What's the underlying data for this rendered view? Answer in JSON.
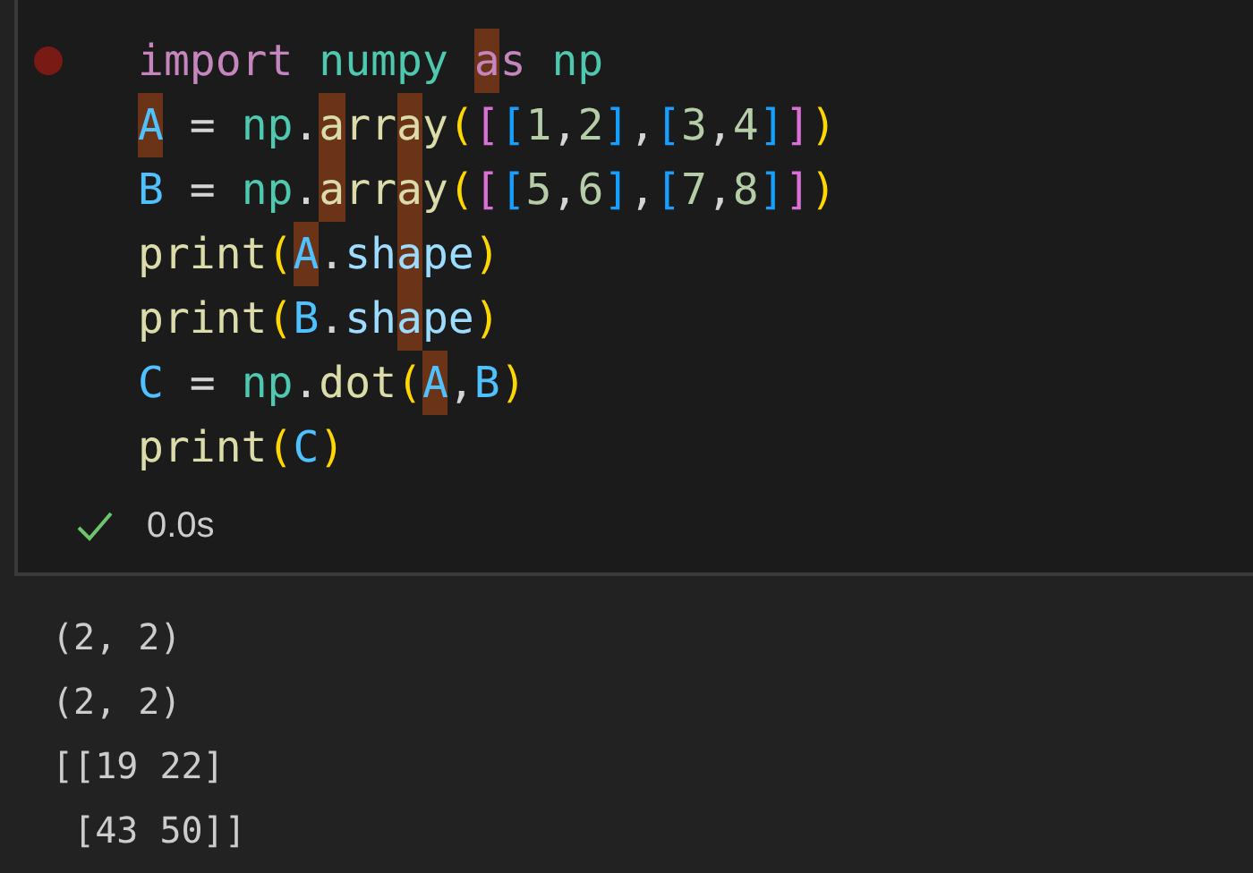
{
  "cell": {
    "breakpoint": true,
    "lines": [
      {
        "tokens": [
          {
            "text": "import ",
            "kind": "keyword",
            "highlighted": false
          },
          {
            "text": "numpy ",
            "kind": "module",
            "highlighted": false
          },
          {
            "text": "a",
            "kind": "keyword",
            "highlighted": true
          },
          {
            "text": "s ",
            "kind": "keyword",
            "highlighted": false
          },
          {
            "text": "np",
            "kind": "module",
            "highlighted": false
          }
        ]
      },
      {
        "tokens": [
          {
            "text": "A",
            "kind": "variable",
            "highlighted": true
          },
          {
            "text": " = ",
            "kind": "plain",
            "highlighted": false
          },
          {
            "text": "np",
            "kind": "module",
            "highlighted": false
          },
          {
            "text": ".",
            "kind": "plain",
            "highlighted": false
          },
          {
            "text": "a",
            "kind": "function",
            "highlighted": true
          },
          {
            "text": "rr",
            "kind": "function",
            "highlighted": false
          },
          {
            "text": "a",
            "kind": "function",
            "highlighted": true
          },
          {
            "text": "y",
            "kind": "function",
            "highlighted": false
          },
          {
            "text": "(",
            "kind": "bracket1",
            "highlighted": false
          },
          {
            "text": "[",
            "kind": "bracket2",
            "highlighted": false
          },
          {
            "text": "[",
            "kind": "bracket3",
            "highlighted": false
          },
          {
            "text": "1",
            "kind": "number",
            "highlighted": false
          },
          {
            "text": ",",
            "kind": "plain",
            "highlighted": false
          },
          {
            "text": "2",
            "kind": "number",
            "highlighted": false
          },
          {
            "text": "]",
            "kind": "bracket3",
            "highlighted": false
          },
          {
            "text": ",",
            "kind": "plain",
            "highlighted": false
          },
          {
            "text": "[",
            "kind": "bracket3",
            "highlighted": false
          },
          {
            "text": "3",
            "kind": "number",
            "highlighted": false
          },
          {
            "text": ",",
            "kind": "plain",
            "highlighted": false
          },
          {
            "text": "4",
            "kind": "number",
            "highlighted": false
          },
          {
            "text": "]",
            "kind": "bracket3",
            "highlighted": false
          },
          {
            "text": "]",
            "kind": "bracket2",
            "highlighted": false
          },
          {
            "text": ")",
            "kind": "bracket1",
            "highlighted": false
          }
        ]
      },
      {
        "tokens": [
          {
            "text": "B",
            "kind": "variable",
            "highlighted": false
          },
          {
            "text": " = ",
            "kind": "plain",
            "highlighted": false
          },
          {
            "text": "np",
            "kind": "module",
            "highlighted": false
          },
          {
            "text": ".",
            "kind": "plain",
            "highlighted": false
          },
          {
            "text": "a",
            "kind": "function",
            "highlighted": true
          },
          {
            "text": "rr",
            "kind": "function",
            "highlighted": false
          },
          {
            "text": "a",
            "kind": "function",
            "highlighted": true
          },
          {
            "text": "y",
            "kind": "function",
            "highlighted": false
          },
          {
            "text": "(",
            "kind": "bracket1",
            "highlighted": false
          },
          {
            "text": "[",
            "kind": "bracket2",
            "highlighted": false
          },
          {
            "text": "[",
            "kind": "bracket3",
            "highlighted": false
          },
          {
            "text": "5",
            "kind": "number",
            "highlighted": false
          },
          {
            "text": ",",
            "kind": "plain",
            "highlighted": false
          },
          {
            "text": "6",
            "kind": "number",
            "highlighted": false
          },
          {
            "text": "]",
            "kind": "bracket3",
            "highlighted": false
          },
          {
            "text": ",",
            "kind": "plain",
            "highlighted": false
          },
          {
            "text": "[",
            "kind": "bracket3",
            "highlighted": false
          },
          {
            "text": "7",
            "kind": "number",
            "highlighted": false
          },
          {
            "text": ",",
            "kind": "plain",
            "highlighted": false
          },
          {
            "text": "8",
            "kind": "number",
            "highlighted": false
          },
          {
            "text": "]",
            "kind": "bracket3",
            "highlighted": false
          },
          {
            "text": "]",
            "kind": "bracket2",
            "highlighted": false
          },
          {
            "text": ")",
            "kind": "bracket1",
            "highlighted": false
          }
        ]
      },
      {
        "tokens": [
          {
            "text": "print",
            "kind": "function",
            "highlighted": false
          },
          {
            "text": "(",
            "kind": "bracket1",
            "highlighted": false
          },
          {
            "text": "A",
            "kind": "variable",
            "highlighted": true
          },
          {
            "text": ".",
            "kind": "plain",
            "highlighted": false
          },
          {
            "text": "sh",
            "kind": "property",
            "highlighted": false
          },
          {
            "text": "a",
            "kind": "property",
            "highlighted": true
          },
          {
            "text": "pe",
            "kind": "property",
            "highlighted": false
          },
          {
            "text": ")",
            "kind": "bracket1",
            "highlighted": false
          }
        ]
      },
      {
        "tokens": [
          {
            "text": "print",
            "kind": "function",
            "highlighted": false
          },
          {
            "text": "(",
            "kind": "bracket1",
            "highlighted": false
          },
          {
            "text": "B",
            "kind": "variable",
            "highlighted": false
          },
          {
            "text": ".",
            "kind": "plain",
            "highlighted": false
          },
          {
            "text": "sh",
            "kind": "property",
            "highlighted": false
          },
          {
            "text": "a",
            "kind": "property",
            "highlighted": true
          },
          {
            "text": "pe",
            "kind": "property",
            "highlighted": false
          },
          {
            "text": ")",
            "kind": "bracket1",
            "highlighted": false
          }
        ]
      },
      {
        "tokens": [
          {
            "text": "C",
            "kind": "variable",
            "highlighted": false
          },
          {
            "text": " = ",
            "kind": "plain",
            "highlighted": false
          },
          {
            "text": "np",
            "kind": "module",
            "highlighted": false
          },
          {
            "text": ".",
            "kind": "plain",
            "highlighted": false
          },
          {
            "text": "dot",
            "kind": "function",
            "highlighted": false
          },
          {
            "text": "(",
            "kind": "bracket1",
            "highlighted": false
          },
          {
            "text": "A",
            "kind": "variable",
            "highlighted": true
          },
          {
            "text": ",",
            "kind": "plain",
            "highlighted": false
          },
          {
            "text": "B",
            "kind": "variable",
            "highlighted": false
          },
          {
            "text": ")",
            "kind": "bracket1",
            "highlighted": false
          }
        ]
      },
      {
        "tokens": [
          {
            "text": "print",
            "kind": "function",
            "highlighted": false
          },
          {
            "text": "(",
            "kind": "bracket1",
            "highlighted": false
          },
          {
            "text": "C",
            "kind": "variable",
            "highlighted": false
          },
          {
            "text": ")",
            "kind": "bracket1",
            "highlighted": false
          }
        ]
      }
    ],
    "status": {
      "success": true,
      "duration": "0.0s"
    }
  },
  "output": {
    "lines": [
      "(2, 2)",
      "(2, 2)",
      "[[19 22]",
      " [43 50]]"
    ]
  }
}
